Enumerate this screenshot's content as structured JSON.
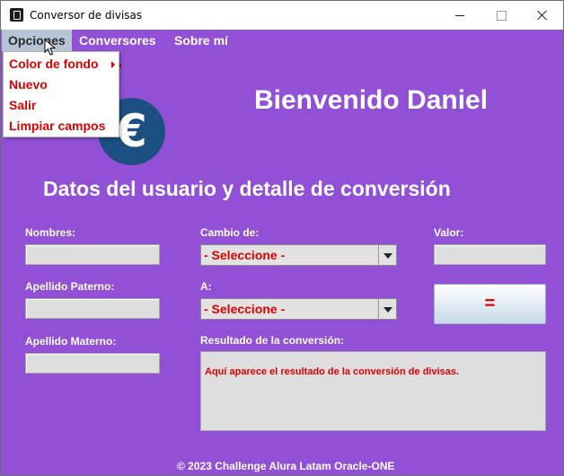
{
  "window": {
    "title": "Conversor de divisas"
  },
  "menubar": {
    "items": [
      "Opciones",
      "Conversores",
      "Sobre mí"
    ]
  },
  "dropdown": {
    "items": [
      "Color de fondo",
      "Nuevo",
      "Salir",
      "Limpiar campos"
    ]
  },
  "header": {
    "logo_symbol": "€",
    "welcome": "Bienvenido Daniel"
  },
  "form": {
    "section_title": "Datos del usuario y detalle de conversión",
    "labels": {
      "nombres": "Nombres:",
      "apellido_paterno": "Apellido Paterno:",
      "apellido_materno": "Apellido Materno:",
      "cambio_de": "Cambio de:",
      "a": "A:",
      "valor": "Valor:",
      "resultado": "Resultado de la conversión:"
    },
    "values": {
      "nombres": "",
      "apellido_paterno": "",
      "apellido_materno": "",
      "valor": ""
    },
    "cambio_de_selected": "- Seleccione -",
    "a_selected": "- Seleccione -",
    "convert_button": "=",
    "result_text": "Aquí aparece el resultado de la conversión de divisas."
  },
  "footer": {
    "text": "© 2023 Challenge Alura Latam Oracle-ONE"
  },
  "colors": {
    "background": "#9150d6",
    "accent_text": "#e00000",
    "logo": "#1c4f82"
  },
  "icons": [
    "app-icon",
    "euro-logo-icon",
    "submenu-arrow-icon",
    "chevron-down-icon",
    "cursor-icon"
  ]
}
